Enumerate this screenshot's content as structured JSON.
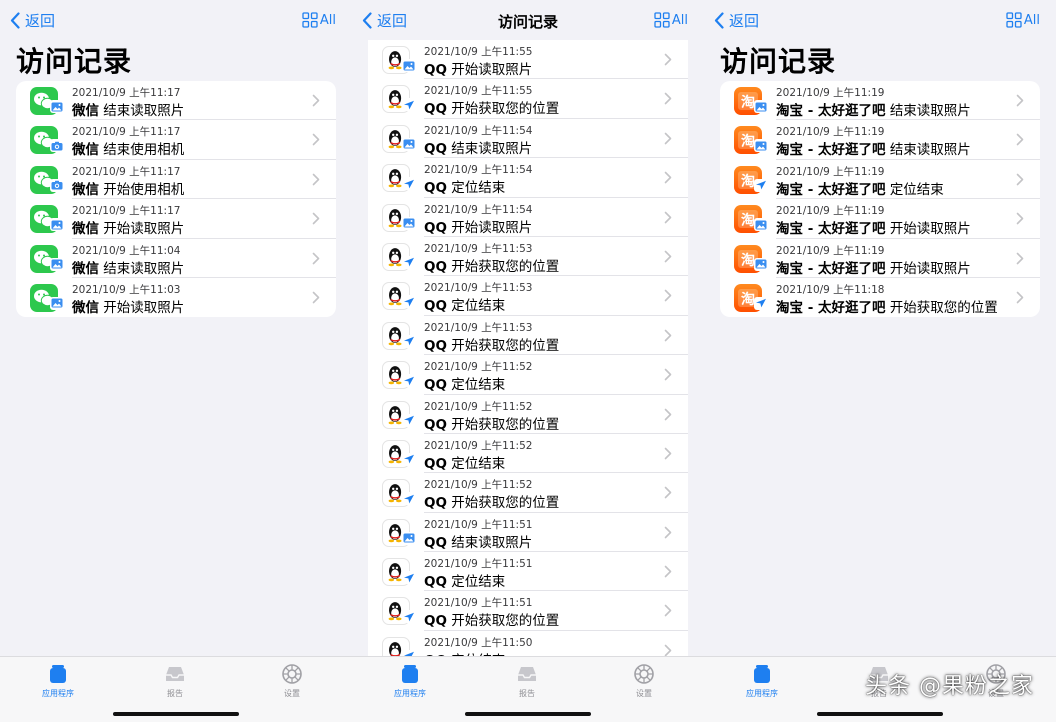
{
  "colors": {
    "accent": "#1e7ff0",
    "wechat": "#2dc84d",
    "taobao": "#ff5a00"
  },
  "panels": [
    {
      "back_label": "返回",
      "all_label": "All",
      "large_title": "访问记录",
      "nav_title": "",
      "rows": [
        {
          "app": "微信",
          "time": "2021/10/9 上午11:17",
          "action": "结束读取照片",
          "icon": "wechat-icon",
          "badge": "photos-icon"
        },
        {
          "app": "微信",
          "time": "2021/10/9 上午11:17",
          "action": "结束使用相机",
          "icon": "wechat-icon",
          "badge": "camera-icon"
        },
        {
          "app": "微信",
          "time": "2021/10/9 上午11:17",
          "action": "开始使用相机",
          "icon": "wechat-icon",
          "badge": "camera-icon"
        },
        {
          "app": "微信",
          "time": "2021/10/9 上午11:17",
          "action": "开始读取照片",
          "icon": "wechat-icon",
          "badge": "photos-icon"
        },
        {
          "app": "微信",
          "time": "2021/10/9 上午11:04",
          "action": "结束读取照片",
          "icon": "wechat-icon",
          "badge": "photos-icon"
        },
        {
          "app": "微信",
          "time": "2021/10/9 上午11:03",
          "action": "开始读取照片",
          "icon": "wechat-icon",
          "badge": "photos-icon"
        }
      ]
    },
    {
      "back_label": "返回",
      "all_label": "All",
      "large_title": "",
      "nav_title": "访问记录",
      "rows": [
        {
          "app": "QQ",
          "time": "2021/10/9 上午11:55",
          "action": "开始读取照片",
          "icon": "qq-icon",
          "badge": "photos-icon"
        },
        {
          "app": "QQ",
          "time": "2021/10/9 上午11:55",
          "action": "开始获取您的位置",
          "icon": "qq-icon",
          "badge": "location-icon"
        },
        {
          "app": "QQ",
          "time": "2021/10/9 上午11:54",
          "action": "结束读取照片",
          "icon": "qq-icon",
          "badge": "photos-icon"
        },
        {
          "app": "QQ",
          "time": "2021/10/9 上午11:54",
          "action": "定位结束",
          "icon": "qq-icon",
          "badge": "location-icon"
        },
        {
          "app": "QQ",
          "time": "2021/10/9 上午11:54",
          "action": "开始读取照片",
          "icon": "qq-icon",
          "badge": "photos-icon"
        },
        {
          "app": "QQ",
          "time": "2021/10/9 上午11:53",
          "action": "开始获取您的位置",
          "icon": "qq-icon",
          "badge": "location-icon"
        },
        {
          "app": "QQ",
          "time": "2021/10/9 上午11:53",
          "action": "定位结束",
          "icon": "qq-icon",
          "badge": "location-icon"
        },
        {
          "app": "QQ",
          "time": "2021/10/9 上午11:53",
          "action": "开始获取您的位置",
          "icon": "qq-icon",
          "badge": "location-icon"
        },
        {
          "app": "QQ",
          "time": "2021/10/9 上午11:52",
          "action": "定位结束",
          "icon": "qq-icon",
          "badge": "location-icon"
        },
        {
          "app": "QQ",
          "time": "2021/10/9 上午11:52",
          "action": "开始获取您的位置",
          "icon": "qq-icon",
          "badge": "location-icon"
        },
        {
          "app": "QQ",
          "time": "2021/10/9 上午11:52",
          "action": "定位结束",
          "icon": "qq-icon",
          "badge": "location-icon"
        },
        {
          "app": "QQ",
          "time": "2021/10/9 上午11:52",
          "action": "开始获取您的位置",
          "icon": "qq-icon",
          "badge": "location-icon"
        },
        {
          "app": "QQ",
          "time": "2021/10/9 上午11:51",
          "action": "结束读取照片",
          "icon": "qq-icon",
          "badge": "photos-icon"
        },
        {
          "app": "QQ",
          "time": "2021/10/9 上午11:51",
          "action": "定位结束",
          "icon": "qq-icon",
          "badge": "location-icon"
        },
        {
          "app": "QQ",
          "time": "2021/10/9 上午11:51",
          "action": "开始获取您的位置",
          "icon": "qq-icon",
          "badge": "location-icon"
        },
        {
          "app": "QQ",
          "time": "2021/10/9 上午11:50",
          "action": "定位结束",
          "icon": "qq-icon",
          "badge": "location-icon"
        }
      ]
    },
    {
      "back_label": "返回",
      "all_label": "All",
      "large_title": "访问记录",
      "nav_title": "",
      "rows": [
        {
          "app": "淘宝 - 太好逛了吧",
          "time": "2021/10/9 上午11:19",
          "action": "结束读取照片",
          "icon": "taobao-icon",
          "badge": "photos-icon"
        },
        {
          "app": "淘宝 - 太好逛了吧",
          "time": "2021/10/9 上午11:19",
          "action": "结束读取照片",
          "icon": "taobao-icon",
          "badge": "photos-icon"
        },
        {
          "app": "淘宝 - 太好逛了吧",
          "time": "2021/10/9 上午11:19",
          "action": "定位结束",
          "icon": "taobao-icon",
          "badge": "location-icon"
        },
        {
          "app": "淘宝 - 太好逛了吧",
          "time": "2021/10/9 上午11:19",
          "action": "开始读取照片",
          "icon": "taobao-icon",
          "badge": "photos-icon"
        },
        {
          "app": "淘宝 - 太好逛了吧",
          "time": "2021/10/9 上午11:19",
          "action": "开始读取照片",
          "icon": "taobao-icon",
          "badge": "photos-icon"
        },
        {
          "app": "淘宝 - 太好逛了吧",
          "time": "2021/10/9 上午11:18",
          "action": "开始获取您的位置",
          "icon": "taobao-icon",
          "badge": "location-icon"
        }
      ]
    }
  ],
  "tabbar": {
    "apps": "应用程序",
    "report": "报告",
    "settings": "设置"
  },
  "watermark": "头条 @果粉之家"
}
